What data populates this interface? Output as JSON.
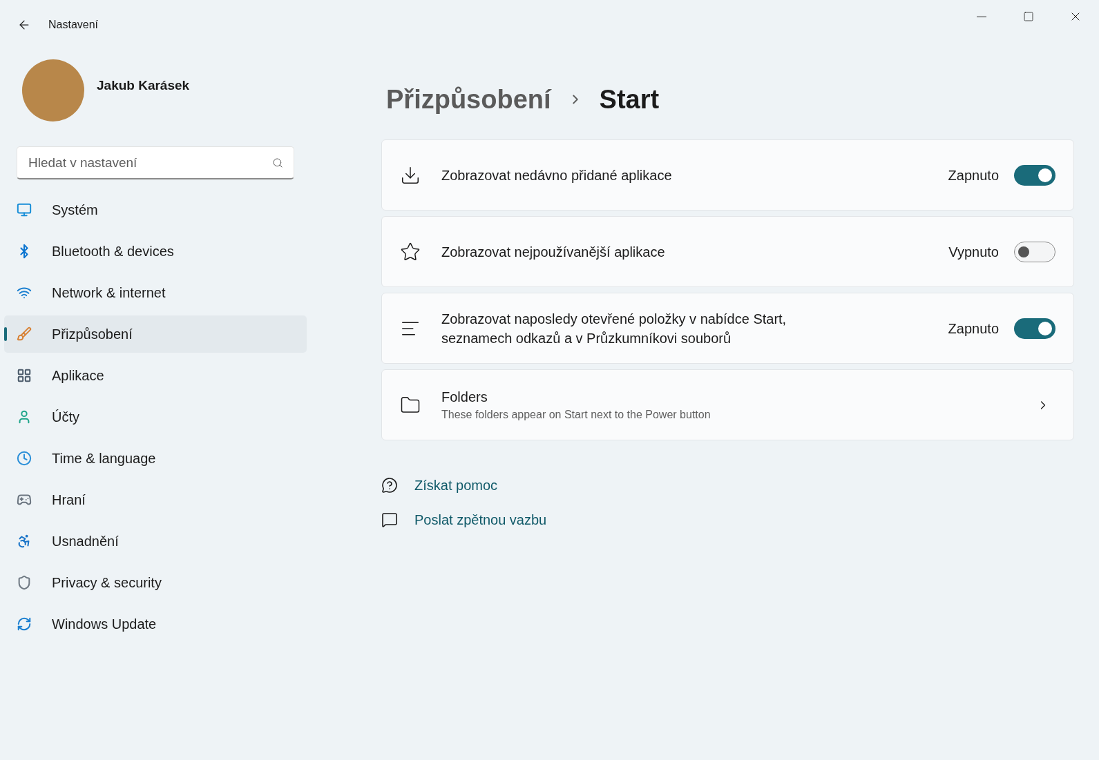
{
  "window": {
    "title": "Nastavení"
  },
  "user": {
    "name": "Jakub Karásek"
  },
  "search": {
    "placeholder": "Hledat v nastavení"
  },
  "sidebar": {
    "items": [
      {
        "label": "Systém",
        "selected": false
      },
      {
        "label": "Bluetooth & devices",
        "selected": false
      },
      {
        "label": "Network & internet",
        "selected": false
      },
      {
        "label": "Přizpůsobení",
        "selected": true
      },
      {
        "label": "Aplikace",
        "selected": false
      },
      {
        "label": "Účty",
        "selected": false
      },
      {
        "label": "Time & language",
        "selected": false
      },
      {
        "label": "Hraní",
        "selected": false
      },
      {
        "label": "Usnadnění",
        "selected": false
      },
      {
        "label": "Privacy & security",
        "selected": false
      },
      {
        "label": "Windows Update",
        "selected": false
      }
    ]
  },
  "breadcrumb": {
    "parent": "Přizpůsobení",
    "current": "Start"
  },
  "settings": [
    {
      "kind": "toggle",
      "label": "Zobrazovat nedávno přidané aplikace",
      "state_label": "Zapnuto",
      "on": true
    },
    {
      "kind": "toggle",
      "label": "Zobrazovat nejpoužívanější aplikace",
      "state_label": "Vypnuto",
      "on": false
    },
    {
      "kind": "toggle",
      "label": "Zobrazovat naposledy otevřené položky v nabídce Start, seznamech odkazů a v Průzkumníkovi souborů",
      "state_label": "Zapnuto",
      "on": true
    },
    {
      "kind": "link",
      "label": "Folders",
      "description": "These folders appear on Start next to the Power button"
    }
  ],
  "links": [
    {
      "label": "Získat pomoc"
    },
    {
      "label": "Poslat zpětnou vazbu"
    }
  ]
}
